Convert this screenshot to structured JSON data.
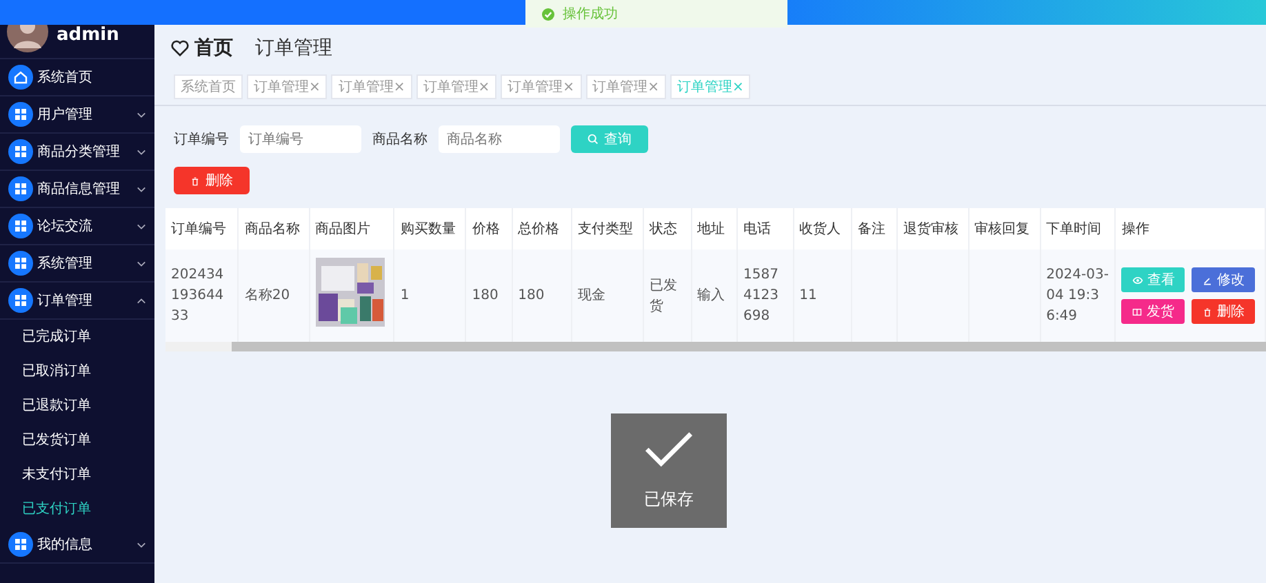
{
  "toast": {
    "text": "操作成功"
  },
  "sidebar": {
    "username": "admin",
    "items": [
      {
        "label": "系统首页",
        "selected": false
      },
      {
        "label": "用户管理",
        "selected": false,
        "expanded": false
      },
      {
        "label": "商品分类管理",
        "selected": false,
        "expanded": false
      },
      {
        "label": "商品信息管理",
        "selected": false,
        "expanded": false
      },
      {
        "label": "论坛交流",
        "selected": false,
        "expanded": false
      },
      {
        "label": "系统管理",
        "selected": false,
        "expanded": false
      },
      {
        "label": "订单管理",
        "selected": false,
        "expanded": true,
        "children": [
          {
            "label": "已完成订单",
            "selected": false
          },
          {
            "label": "已取消订单",
            "selected": false
          },
          {
            "label": "已退款订单",
            "selected": false
          },
          {
            "label": "已发货订单",
            "selected": false
          },
          {
            "label": "未支付订单",
            "selected": false
          },
          {
            "label": "已支付订单",
            "selected": true
          }
        ]
      },
      {
        "label": "我的信息",
        "selected": false,
        "expanded": false
      }
    ]
  },
  "breadcrumb": [
    "首页",
    "订单管理"
  ],
  "tabs": [
    {
      "label": "系统首页",
      "selected": false
    },
    {
      "label": "订单管理",
      "close": "×",
      "selected": false
    },
    {
      "label": "订单管理",
      "close": "×",
      "selected": false
    },
    {
      "label": "订单管理",
      "close": "×",
      "selected": false
    },
    {
      "label": "订单管理",
      "close": "×",
      "selected": false
    },
    {
      "label": "订单管理",
      "close": "×",
      "selected": false
    },
    {
      "label": "订单管理",
      "close": "×",
      "selected": true
    }
  ],
  "search": {
    "fields": [
      {
        "label": "订单编号",
        "placeholder": "订单编号"
      },
      {
        "label": "商品名称",
        "placeholder": "商品名称"
      }
    ],
    "button": "查询"
  },
  "delete_button": "删除",
  "table": {
    "columns": [
      "订单编号",
      "商品名称",
      "商品图片",
      "购买数量",
      "价格",
      "总价格",
      "支付类型",
      "状态",
      "地址",
      "电话",
      "收货人",
      "备注",
      "退货审核",
      "审核回复",
      "下单时间",
      "操作"
    ],
    "rows": [
      {
        "cells": [
          {
            "kind": "text",
            "text": "20243419364433"
          },
          {
            "kind": "text",
            "text": "名称20"
          },
          {
            "kind": "picture"
          },
          {
            "kind": "text",
            "text": "1"
          },
          {
            "kind": "text",
            "text": "180"
          },
          {
            "kind": "text",
            "text": "180"
          },
          {
            "kind": "text",
            "text": "现金"
          },
          {
            "kind": "text",
            "text": "已发货"
          },
          {
            "kind": "text",
            "text": "输入"
          },
          {
            "kind": "text",
            "text": "15874123698"
          },
          {
            "kind": "text",
            "text": "11"
          },
          {
            "kind": "empty"
          },
          {
            "kind": "empty"
          },
          {
            "kind": "empty"
          },
          {
            "kind": "text",
            "text": "2024-03-04 19:36:49"
          },
          {
            "kind": "actions",
            "buttons": [
              {
                "label": "查看",
                "kind": "view",
                "color": "#2ed3c4"
              },
              {
                "label": "修改",
                "kind": "edit",
                "color": "#4b6fd9"
              },
              {
                "label": "发货",
                "kind": "ship",
                "color": "#f52a8a"
              },
              {
                "label": "删除",
                "kind": "delete",
                "color": "#f5352a"
              }
            ]
          }
        ]
      }
    ]
  },
  "dialog": {
    "text": "已保存"
  }
}
